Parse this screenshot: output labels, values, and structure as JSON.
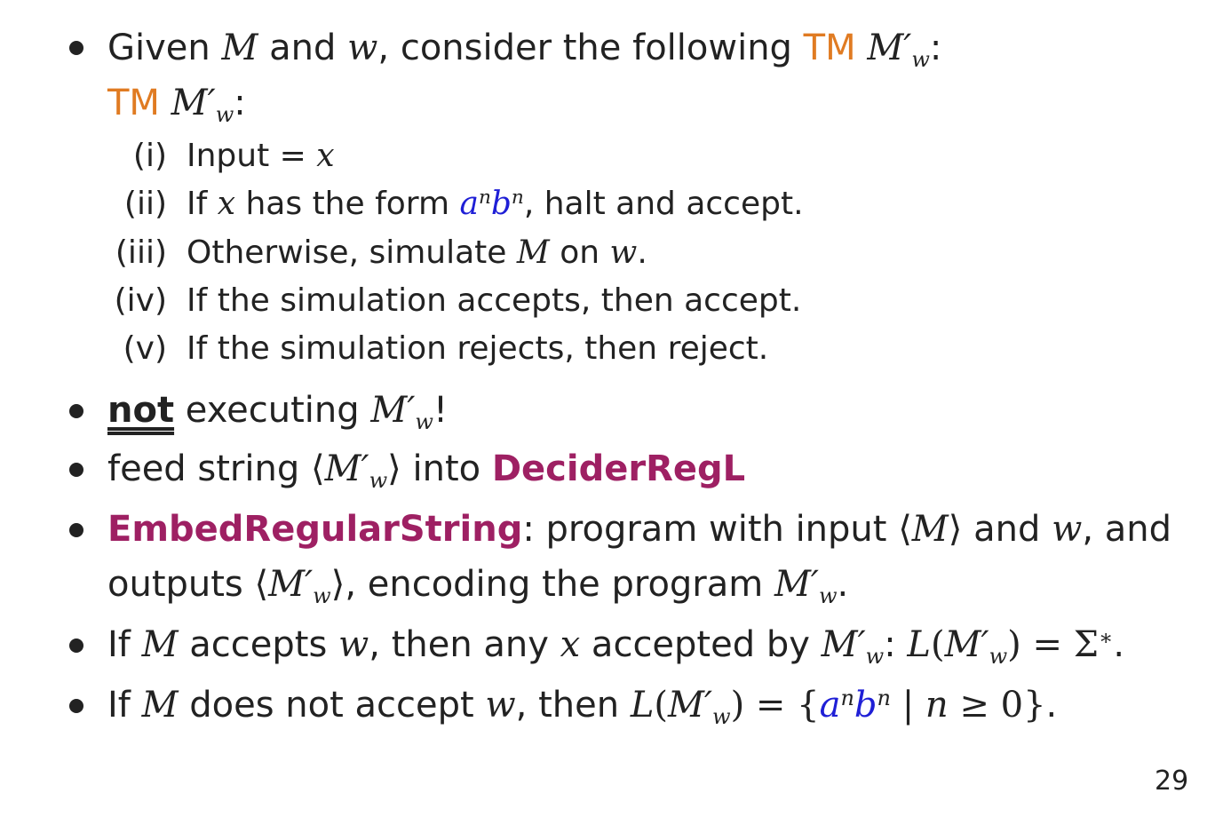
{
  "bullets": {
    "b1": {
      "given": "Given",
      "m": "M",
      "and1": "and",
      "w": "w",
      "rest": ", consider the following",
      "tm": "TM",
      "mprime": "M′",
      "msub": "w",
      "colon": ":"
    },
    "tm_line": {
      "tm": "TM",
      "mprime": "M′",
      "msub": "w",
      "colon": ":"
    },
    "steps": [
      {
        "label": "(i)",
        "text_a": "Input = ",
        "var": "x"
      },
      {
        "label": "(ii)",
        "text_a": "If ",
        "var": "x",
        "text_b": " has the form ",
        "a": "a",
        "n1": "n",
        "b": "b",
        "n2": "n",
        "text_c": ", halt and accept."
      },
      {
        "label": "(iii)",
        "text_a": "Otherwise, simulate ",
        "m": "M",
        "text_b": " on ",
        "w": "w",
        "text_c": "."
      },
      {
        "label": "(iv)",
        "text_a": "If the simulation accepts, then accept."
      },
      {
        "label": "(v)",
        "text_a": "If the simulation rejects, then reject."
      }
    ],
    "b2": {
      "not": "not",
      "rest": " executing ",
      "mprime": "M′",
      "msub": "w",
      "excl": "!"
    },
    "b3": {
      "text": "feed string ",
      "lang": "⟨",
      "mprime": "M′",
      "msub": "w",
      "rang": "⟩",
      "into": " into ",
      "decider": "DeciderRegL"
    },
    "b4": {
      "embed": "EmbedRegularString",
      "rest1": ": program with input ",
      "lang": "⟨",
      "m": "M",
      "rang": "⟩",
      "and": " and ",
      "w": "w",
      "rest2": ", and",
      "line2_a": "outputs ",
      "lang2": "⟨",
      "mprime": "M′",
      "msub": "w",
      "rang2": "⟩",
      "line2_b": ", encoding the program ",
      "mprime2": "M′",
      "msub2": "w",
      "period": "."
    },
    "b5": {
      "a": "If ",
      "m": "M",
      "b": " accepts ",
      "w": "w",
      "c": ", then any ",
      "x": "x",
      "d": " accepted by ",
      "mprime": "M′",
      "msub": "w",
      "e": ": ",
      "l": "L",
      "lp": "(",
      "mprime2": "M′",
      "msub2": "w",
      "rp": ")",
      "eq": " = Σ",
      "star": "∗",
      "period": "."
    },
    "b6": {
      "a": "If ",
      "m": "M",
      "b": " does not accept ",
      "w": "w",
      "c": ", then ",
      "l": "L",
      "lp": "(",
      "mprime": "M′",
      "msub": "w",
      "rp": ")",
      "eq": " = {",
      "an": "a",
      "n1": "n",
      "bn": "b",
      "n2": "n",
      "bar": " | ",
      "n": "n",
      "ge": " ≥ 0}",
      "period": "."
    }
  },
  "page_number": "29",
  "colors": {
    "orange": "#e07b22",
    "blue": "#1f1fd6",
    "magenta": "#9e2063"
  }
}
